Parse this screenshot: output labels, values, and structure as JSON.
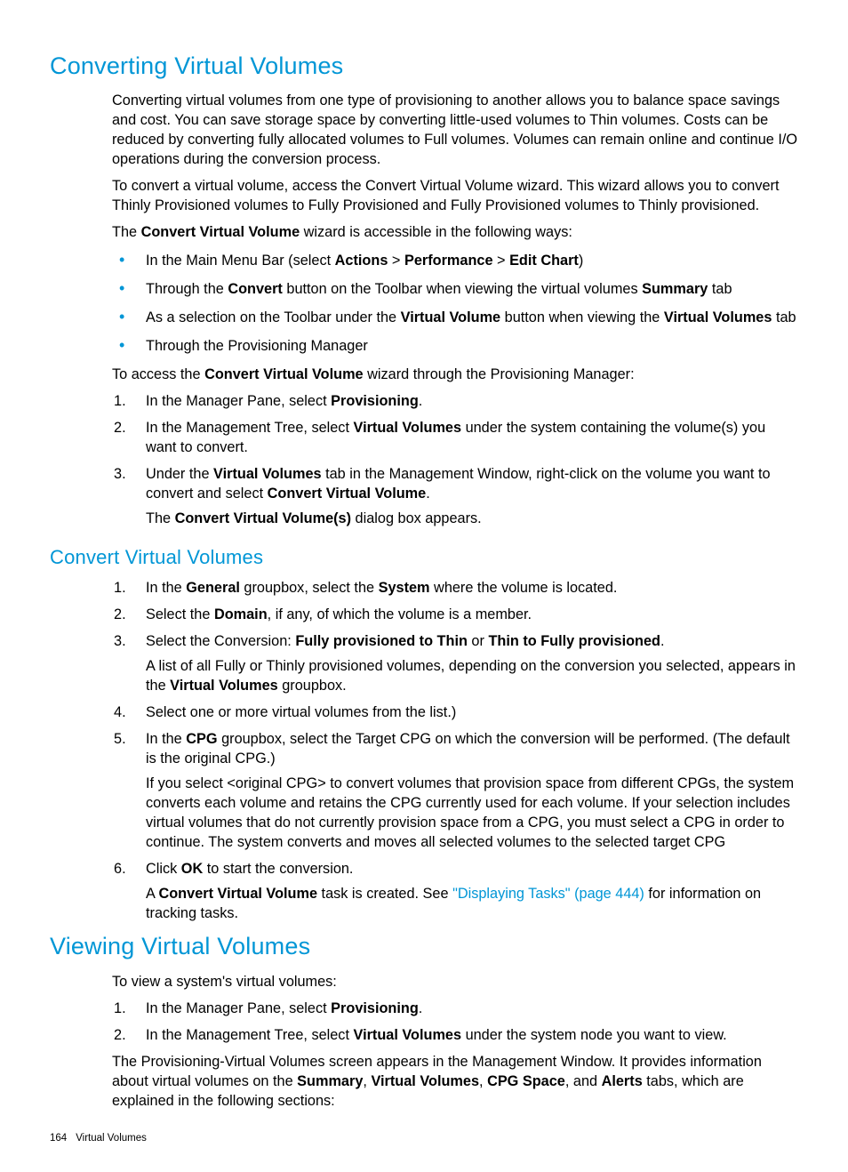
{
  "h1_converting": "Converting Virtual Volumes",
  "p_intro1": "Converting virtual volumes from one type of provisioning to another allows you to balance space savings and cost. You can save storage space by converting little-used volumes to Thin volumes. Costs can be reduced by converting fully allocated volumes to Full volumes. Volumes can remain online and continue I/O operations during the conversion process.",
  "p_intro2": "To convert a virtual volume, access the Convert Virtual Volume wizard. This wizard allows you to convert Thinly Provisioned volumes to Fully Provisioned and Fully Provisioned volumes to Thinly provisioned.",
  "p_intro3_a": "The ",
  "p_intro3_b": "Convert Virtual Volume",
  "p_intro3_c": " wizard is accessible in the following ways:",
  "bul1_a": "In the Main Menu Bar (select ",
  "bul1_b": "Actions",
  "bul1_c": " > ",
  "bul1_d": "Performance",
  "bul1_e": " > ",
  "bul1_f": "Edit Chart",
  "bul1_g": ")",
  "bul2_a": "Through the ",
  "bul2_b": "Convert",
  "bul2_c": " button on the Toolbar when viewing the virtual volumes ",
  "bul2_d": "Summary",
  "bul2_e": " tab",
  "bul3_a": "As a selection on the Toolbar under the ",
  "bul3_b": "Virtual Volume",
  "bul3_c": " button when viewing the ",
  "bul3_d": "Virtual Volumes",
  "bul3_e": " tab",
  "bul4": "Through the Provisioning Manager",
  "p_access_a": "To access the ",
  "p_access_b": "Convert Virtual Volume",
  "p_access_c": " wizard through the Provisioning Manager:",
  "ol1_1_a": "In the Manager Pane, select ",
  "ol1_1_b": "Provisioning",
  "ol1_1_c": ".",
  "ol1_2_a": "In the Management Tree, select ",
  "ol1_2_b": "Virtual Volumes",
  "ol1_2_c": " under the system containing the volume(s) you want to convert.",
  "ol1_3_a": "Under the ",
  "ol1_3_b": "Virtual Volumes",
  "ol1_3_c": " tab in the Management Window, right-click on the volume you want to convert and select ",
  "ol1_3_d": "Convert Virtual Volume",
  "ol1_3_e": ".",
  "ol1_3_sub_a": "The ",
  "ol1_3_sub_b": "Convert Virtual Volume(s)",
  "ol1_3_sub_c": " dialog box appears.",
  "h2_convert": "Convert Virtual Volumes",
  "ol2_1_a": "In the ",
  "ol2_1_b": "General",
  "ol2_1_c": " groupbox, select the ",
  "ol2_1_d": "System",
  "ol2_1_e": " where the volume is located.",
  "ol2_2_a": "Select the ",
  "ol2_2_b": "Domain",
  "ol2_2_c": ", if any, of which the volume is a member.",
  "ol2_3_a": "Select the Conversion: ",
  "ol2_3_b": "Fully provisioned to Thin",
  "ol2_3_c": " or ",
  "ol2_3_d": "Thin to Fully provisioned",
  "ol2_3_e": ".",
  "ol2_3_sub_a": "A list of all Fully or Thinly provisioned volumes, depending on the conversion you selected, appears in the ",
  "ol2_3_sub_b": "Virtual Volumes",
  "ol2_3_sub_c": " groupbox.",
  "ol2_4": "Select one or more virtual volumes from the list.)",
  "ol2_5_a": "In the ",
  "ol2_5_b": "CPG",
  "ol2_5_c": " groupbox, select the Target CPG on which the conversion will be performed. (The default is the original CPG.)",
  "ol2_5_sub": "If you select <original CPG> to convert volumes that provision space from different CPGs, the system converts each volume and retains the CPG currently used for each volume. If your selection includes virtual volumes that do not currently provision space from a CPG, you must select a CPG in order to continue. The system converts and moves all selected volumes to the selected target CPG",
  "ol2_6_a": "Click ",
  "ol2_6_b": "OK",
  "ol2_6_c": " to start the conversion.",
  "ol2_6_sub_a": "A ",
  "ol2_6_sub_b": "Convert Virtual Volume",
  "ol2_6_sub_c": " task is created. See ",
  "ol2_6_sub_link": "\"Displaying Tasks\" (page 444)",
  "ol2_6_sub_d": " for information on tracking tasks.",
  "h1_viewing": "Viewing Virtual Volumes",
  "p_view_intro": "To view a system's virtual volumes:",
  "ol3_1_a": "In the Manager Pane, select ",
  "ol3_1_b": "Provisioning",
  "ol3_1_c": ".",
  "ol3_2_a": "In the Management Tree, select ",
  "ol3_2_b": "Virtual Volumes",
  "ol3_2_c": " under the system node you want to view.",
  "p_view_end_a": "The Provisioning-Virtual Volumes screen appears in the Management Window. It provides information about virtual volumes on the ",
  "p_view_end_b": "Summary",
  "p_view_end_c": ", ",
  "p_view_end_d": "Virtual Volumes",
  "p_view_end_e": ", ",
  "p_view_end_f": "CPG Space",
  "p_view_end_g": ", and ",
  "p_view_end_h": "Alerts",
  "p_view_end_i": " tabs, which are explained in the following sections:",
  "footer_page": "164",
  "footer_title": "Virtual Volumes"
}
